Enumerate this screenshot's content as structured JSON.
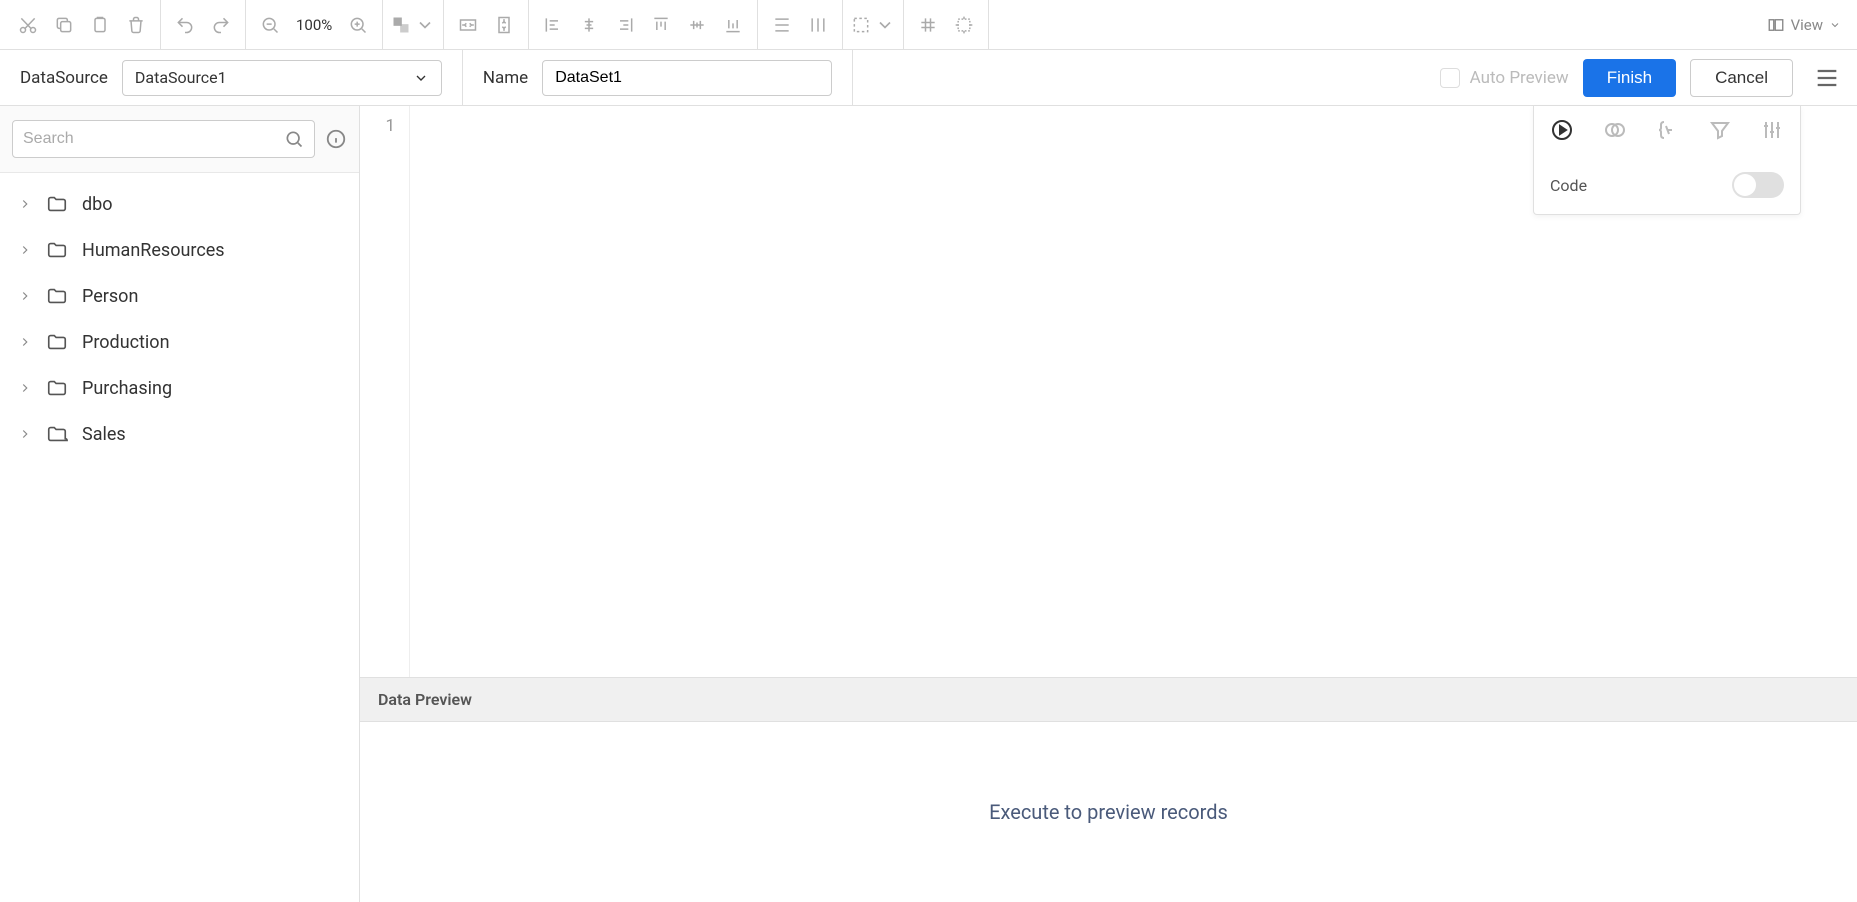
{
  "toolbar": {
    "zoom": "100%",
    "view_label": "View"
  },
  "config": {
    "datasource_label": "DataSource",
    "datasource_value": "DataSource1",
    "name_label": "Name",
    "name_value": "DataSet1",
    "auto_preview_label": "Auto Preview",
    "finish_label": "Finish",
    "cancel_label": "Cancel"
  },
  "sidebar": {
    "search_placeholder": "Search",
    "items": [
      {
        "label": "dbo"
      },
      {
        "label": "HumanResources"
      },
      {
        "label": "Person"
      },
      {
        "label": "Production"
      },
      {
        "label": "Purchasing"
      },
      {
        "label": "Sales"
      }
    ]
  },
  "editor": {
    "line_number": "1",
    "code_toggle_label": "Code"
  },
  "preview": {
    "header": "Data Preview",
    "empty_message": "Execute to preview records"
  }
}
